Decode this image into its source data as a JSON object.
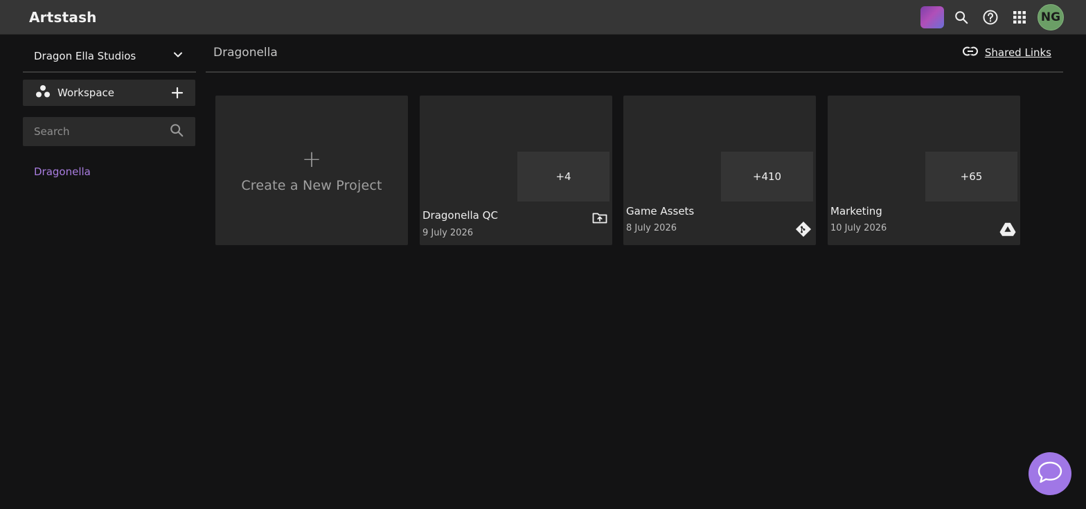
{
  "app": {
    "title": "Artstash"
  },
  "header": {
    "icons": [
      "org-logo",
      "search-icon",
      "help-icon",
      "apps-grid-icon"
    ],
    "avatar_initials": "NG",
    "avatar_color": "#6b9e66"
  },
  "sidebar": {
    "org_name": "Dragon Ella Studios",
    "workspace_label": "Workspace",
    "search_placeholder": "Search",
    "items": [
      {
        "label": "Dragonella",
        "active": true
      }
    ]
  },
  "main": {
    "breadcrumb": "Dragonella",
    "shared_links_label": "Shared Links",
    "create_label": "Create a New Project",
    "projects": [
      {
        "name": "Dragonella QC",
        "date": "9 July 2026",
        "count": "+4",
        "source_icon": "folder-upload-icon"
      },
      {
        "name": "Game Assets",
        "date": "8 July 2026",
        "count": "+410",
        "source_icon": "git-icon"
      },
      {
        "name": "Marketing",
        "date": "10 July 2026",
        "count": "+65",
        "source_icon": "google-drive-icon"
      }
    ]
  },
  "colors": {
    "accent": "#a97de0",
    "chat_button": "#a077e6",
    "background": "#131314",
    "card": "#282828"
  }
}
